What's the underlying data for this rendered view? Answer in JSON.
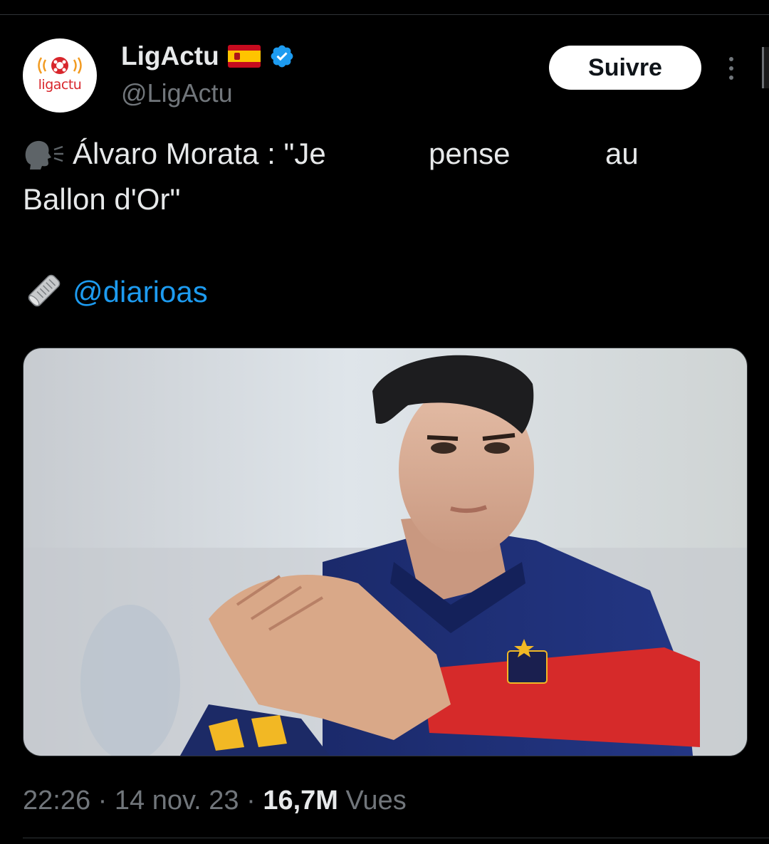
{
  "account": {
    "display_name": "LigActu",
    "handle": "@LigActu",
    "avatar_text": "ligactu",
    "verified": true,
    "flag": "spain-flag-icon"
  },
  "actions": {
    "follow_label": "Suivre",
    "more_icon": "more-vertical-icon"
  },
  "tweet": {
    "speaking_emoji": "🗣",
    "quote_word1": "Álvaro Morata : \"Je",
    "quote_word2": "pense",
    "quote_word3": "au",
    "quote_line2": "Ballon d'Or\"",
    "source_emoji": "🗞",
    "mention": "@diarioas"
  },
  "media": {
    "type": "photo"
  },
  "meta": {
    "time": "22:26",
    "sep1": "·",
    "date": "14 nov. 23",
    "sep2": "·",
    "views_count": "16,7M",
    "views_label": "Vues"
  },
  "colors": {
    "background": "#000000",
    "text": "#e7e9ea",
    "secondary": "#71767b",
    "link": "#1d9bf0",
    "verified": "#1d9bf0",
    "brand_red": "#d8262c"
  }
}
